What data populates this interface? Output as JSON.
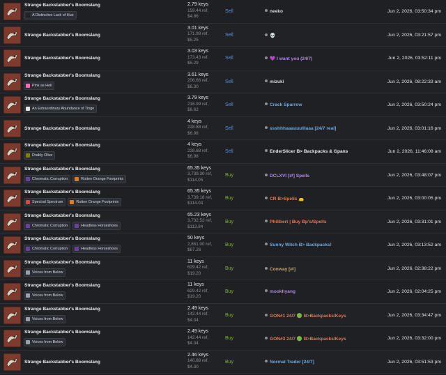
{
  "colors": {
    "sell": "#5b8fd6",
    "buy": "#7cb04a",
    "background": "#1c1e22"
  },
  "listings": [
    {
      "item": "Strange Backstabber's Boomslang",
      "tags": [
        {
          "label": "A Distinctive Lack of Hue",
          "icon": "paint-can-icon",
          "color": "#222222"
        }
      ],
      "keys": "2.79 keys",
      "ref": "159.44 ref,",
      "usd": "$4.86",
      "intent": "Sell",
      "trader": "neeko",
      "trader_color": "#d6d8db",
      "date": "Jun 2, 2026, 03:50:34 pm"
    },
    {
      "item": "Strange Backstabber's Boomslang",
      "tags": [],
      "keys": "3.01 keys",
      "ref": "171.99 ref,",
      "usd": "$5.25",
      "intent": "Sell",
      "trader": "💀",
      "trader_color": "#d6d8db",
      "date": "Jun 2, 2026, 03:21:57 pm"
    },
    {
      "item": "Strange Backstabber's Boomslang",
      "tags": [],
      "keys": "3.03 keys",
      "ref": "173.43 ref,",
      "usd": "$5.29",
      "intent": "Sell",
      "trader": "💜 I want you (24/7)",
      "trader_color": "#b085e0",
      "date": "Jun 2, 2026, 03:52:11 pm"
    },
    {
      "item": "Strange Backstabber's Boomslang",
      "tags": [
        {
          "label": "Pink as Hell",
          "icon": "paint-can-icon",
          "color": "#ff69b4"
        }
      ],
      "keys": "3.61 keys",
      "ref": "206.66 ref,",
      "usd": "$6.30",
      "intent": "Sell",
      "trader": "mizuki",
      "trader_color": "#d6d8db",
      "date": "Jun 2, 2026, 08:22:33 am"
    },
    {
      "item": "Strange Backstabber's Boomslang",
      "tags": [
        {
          "label": "An Extraordinary Abundance of Tinge",
          "icon": "paint-can-icon",
          "color": "#e6e6e6"
        }
      ],
      "keys": "3.79 keys",
      "ref": "216.99 ref,",
      "usd": "$6.62",
      "intent": "Sell",
      "trader": "Crack Sparrow",
      "trader_color": "#6fa8dc",
      "date": "Jun 2, 2026, 03:50:24 pm"
    },
    {
      "item": "Strange Backstabber's Boomslang",
      "tags": [],
      "keys": "4 keys",
      "ref": "228.88 ref,",
      "usd": "$6.98",
      "intent": "Sell",
      "trader": "ssshhhaaauuulllaaa [24/7 real]",
      "trader_color": "#6fa8dc",
      "date": "Jun 2, 2026, 03:01:16 pm"
    },
    {
      "item": "Strange Backstabber's Boomslang",
      "tags": [
        {
          "label": "Drably Olive",
          "icon": "paint-can-icon",
          "color": "#808000"
        }
      ],
      "keys": "4 keys",
      "ref": "228.88 ref,",
      "usd": "$6.98",
      "intent": "Sell",
      "trader": "EnderSlicer B> Backpacks & Gpans",
      "trader_color": "#e9ebed",
      "date": "Jun 2, 2026, 11:46:08 am"
    },
    {
      "item": "Strange Backstabber's Boomslang",
      "tags": [
        {
          "label": "Chromatic Corruption",
          "icon": "spell-icon",
          "color": "#6a3fa0"
        },
        {
          "label": "Rotten Orange Footprints",
          "icon": "spell-icon",
          "color": "#e07a1f"
        }
      ],
      "keys": "65.35 keys",
      "ref": "3,739.30 ref,",
      "usd": "$114.05",
      "intent": "Buy",
      "trader": "DCLXVI [⇄] Spells",
      "trader_color": "#b085e0",
      "date": "Jun 2, 2026, 03:48:07 pm"
    },
    {
      "item": "Strange Backstabber's Boomslang",
      "tags": [
        {
          "label": "Spectral Spectrum",
          "icon": "spell-icon",
          "color": "#d94a3a"
        },
        {
          "label": "Rotten Orange Footprints",
          "icon": "spell-icon",
          "color": "#e07a1f"
        }
      ],
      "keys": "65.35 keys",
      "ref": "3,739.18 ref,",
      "usd": "$114.04",
      "intent": "Buy",
      "trader": "CR B>Spells 👝",
      "trader_color": "#e07a50",
      "date": "Jun 2, 2026, 03:00:05 pm"
    },
    {
      "item": "Strange Backstabber's Boomslang",
      "tags": [
        {
          "label": "Chromatic Corruption",
          "icon": "spell-icon",
          "color": "#6a3fa0"
        },
        {
          "label": "Headless Horseshoes",
          "icon": "spell-icon",
          "color": "#6a3fa0"
        }
      ],
      "keys": "65.23 keys",
      "ref": "3,732.52 ref,",
      "usd": "$113.84",
      "intent": "Buy",
      "trader": "Philibert | Buy Bp's/Spells",
      "trader_color": "#e07a50",
      "date": "Jun 2, 2026, 03:31:01 pm"
    },
    {
      "item": "Strange Backstabber's Boomslang",
      "tags": [
        {
          "label": "Chromatic Corruption",
          "icon": "spell-icon",
          "color": "#6a3fa0"
        },
        {
          "label": "Headless Horseshoes",
          "icon": "spell-icon",
          "color": "#6a3fa0"
        }
      ],
      "keys": "50 keys",
      "ref": "2,861.00 ref,",
      "usd": "$87.26",
      "intent": "Buy",
      "trader": "Sunny Witch B> Backpacks!",
      "trader_color": "#6fa8dc",
      "date": "Jun 2, 2026, 03:13:52 am"
    },
    {
      "item": "Strange Backstabber's Boomslang",
      "tags": [
        {
          "label": "Voices from Below",
          "icon": "spell-icon",
          "color": "#9aa0a8"
        }
      ],
      "keys": "11 keys",
      "ref": "629.42 ref,",
      "usd": "$19.20",
      "intent": "Buy",
      "trader": "Conway [⇄]",
      "trader_color": "#c9a96e",
      "date": "Jun 2, 2026, 02:38:22 pm"
    },
    {
      "item": "Strange Backstabber's Boomslang",
      "tags": [
        {
          "label": "Voices from Below",
          "icon": "spell-icon",
          "color": "#9aa0a8"
        }
      ],
      "keys": "11 keys",
      "ref": "629.42 ref,",
      "usd": "$19.20",
      "intent": "Buy",
      "trader": "mookhyang",
      "trader_color": "#b085e0",
      "date": "Jun 2, 2026, 02:04:25 pm"
    },
    {
      "item": "Strange Backstabber's Boomslang",
      "tags": [
        {
          "label": "Voices from Below",
          "icon": "spell-icon",
          "color": "#9aa0a8"
        }
      ],
      "keys": "2.49 keys",
      "ref": "142.44 ref,",
      "usd": "$4.34",
      "intent": "Buy",
      "trader": "GON#1 24/7 🟢 B>Backpacks/Keys",
      "trader_color": "#e07a50",
      "date": "Jun 2, 2026, 03:34:47 pm"
    },
    {
      "item": "Strange Backstabber's Boomslang",
      "tags": [
        {
          "label": "Voices from Below",
          "icon": "spell-icon",
          "color": "#9aa0a8"
        }
      ],
      "keys": "2.49 keys",
      "ref": "142.44 ref,",
      "usd": "$4.34",
      "intent": "Buy",
      "trader": "GON#3 24/7 🟢 B>Backpacks/Keys",
      "trader_color": "#e07a50",
      "date": "Jun 2, 2026, 03:32:00 pm"
    },
    {
      "item": "Strange Backstabber's Boomslang",
      "tags": [],
      "keys": "2.46 keys",
      "ref": "140.88 ref,",
      "usd": "$4.30",
      "intent": "Buy",
      "trader": "Normal Trader [24/7]",
      "trader_color": "#6fa8dc",
      "date": "Jun 2, 2026, 03:51:53 pm"
    }
  ]
}
